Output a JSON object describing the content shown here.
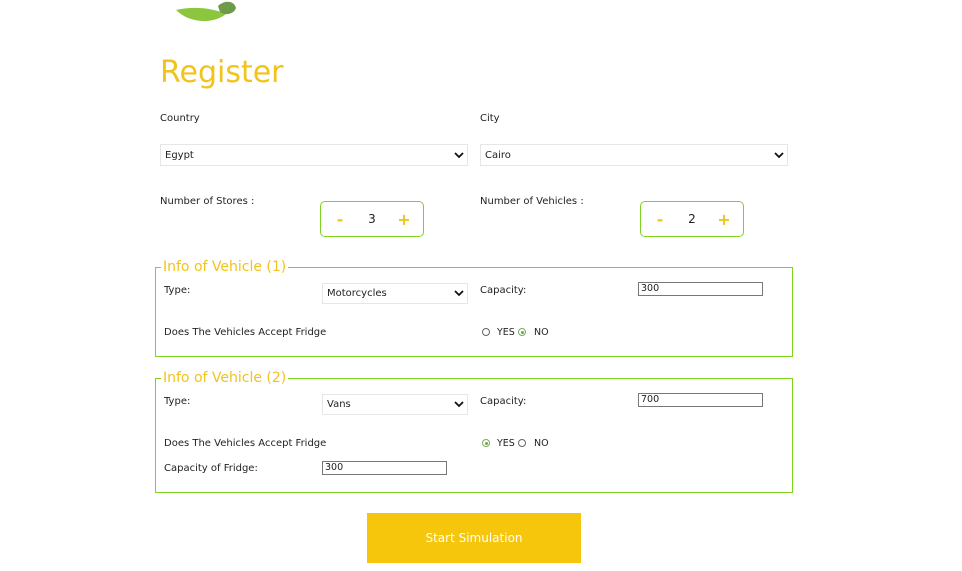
{
  "page": {
    "title": "Register"
  },
  "location": {
    "country_label": "Country",
    "country_value": "Egypt",
    "city_label": "City",
    "city_value": "Cairo"
  },
  "stores": {
    "label": "Number of Stores :",
    "minus": "-",
    "value": "3",
    "plus": "+"
  },
  "vehicles": {
    "label": "Number of Vehicles :",
    "minus": "-",
    "value": "2",
    "plus": "+"
  },
  "vehicle_1": {
    "legend": "Info of Vehicle (1)",
    "type_label": "Type:",
    "type_value": "Motorcycles",
    "capacity_label": "Capacity:",
    "capacity_value": "300",
    "fridge_question": "Does The Vehicles Accept Fridge",
    "yes_label": "YES",
    "no_label": "NO",
    "fridge_selected": "NO"
  },
  "vehicle_2": {
    "legend": "Info of Vehicle (2)",
    "type_label": "Type:",
    "type_value": "Vans",
    "capacity_label": "Capacity:",
    "capacity_value": "700",
    "fridge_question": "Does The Vehicles Accept Fridge",
    "yes_label": "YES",
    "no_label": "NO",
    "fridge_selected": "YES",
    "fridge_capacity_label": "Capacity of Fridge:",
    "fridge_capacity_value": "300"
  },
  "submit": {
    "label": "Start Simulation"
  },
  "colors": {
    "accent": "#f2c31a",
    "border_green": "#7ed321",
    "button": "#f5c60c"
  },
  "icons": {
    "logo": "leaf-logo",
    "dropdown": "chevron-down-icon"
  }
}
